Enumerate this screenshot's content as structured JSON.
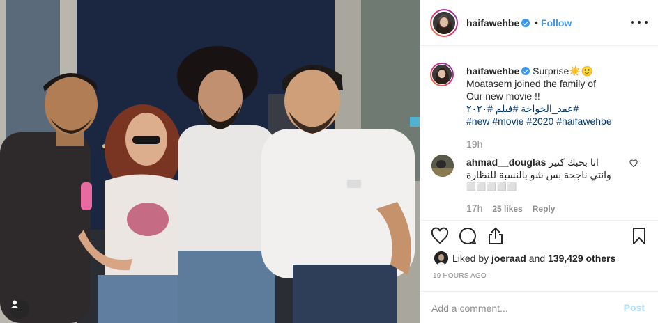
{
  "post": {
    "username": "haifawehbe",
    "dot": "•",
    "follow_label": "Follow",
    "caption": {
      "username": "haifawehbe",
      "line1": "Surprise☀️🙂",
      "line2": "Moatasem joined the family of",
      "line3": "Our new movie !!",
      "line4": "#عقد_الخواجة #فيلم #٢٠٢٠",
      "line5": "#new #movie #2020 #haifawehbe"
    },
    "caption_time": "19h",
    "comment": {
      "username": "ahmad__douglas",
      "text_line1": "انا بحبك كتير",
      "text_line2": "وانتي ناجحة بس شو بالنسبة للنظارة",
      "text_line3": "⬜⬜⬜⬜⬜",
      "time": "17h",
      "likes": "25 likes",
      "reply_label": "Reply"
    },
    "likes": {
      "prefix": "Liked by",
      "user": "joeraad",
      "and": "and",
      "count": "139,429 others"
    },
    "timestamp": "19 HOURS AGO",
    "add_comment_placeholder": "Add a comment...",
    "post_label": "Post"
  },
  "icons": {
    "more": "more-options-icon",
    "verified": "verified-badge-icon",
    "like": "heart-icon",
    "comment": "comment-bubble-icon",
    "share": "share-icon",
    "save": "bookmark-icon",
    "user_tag": "user-tag-icon"
  },
  "colors": {
    "link_blue": "#3897f0",
    "hashtag": "#003569",
    "muted": "#8e8e8e",
    "text": "#262626",
    "border": "#efefef"
  }
}
